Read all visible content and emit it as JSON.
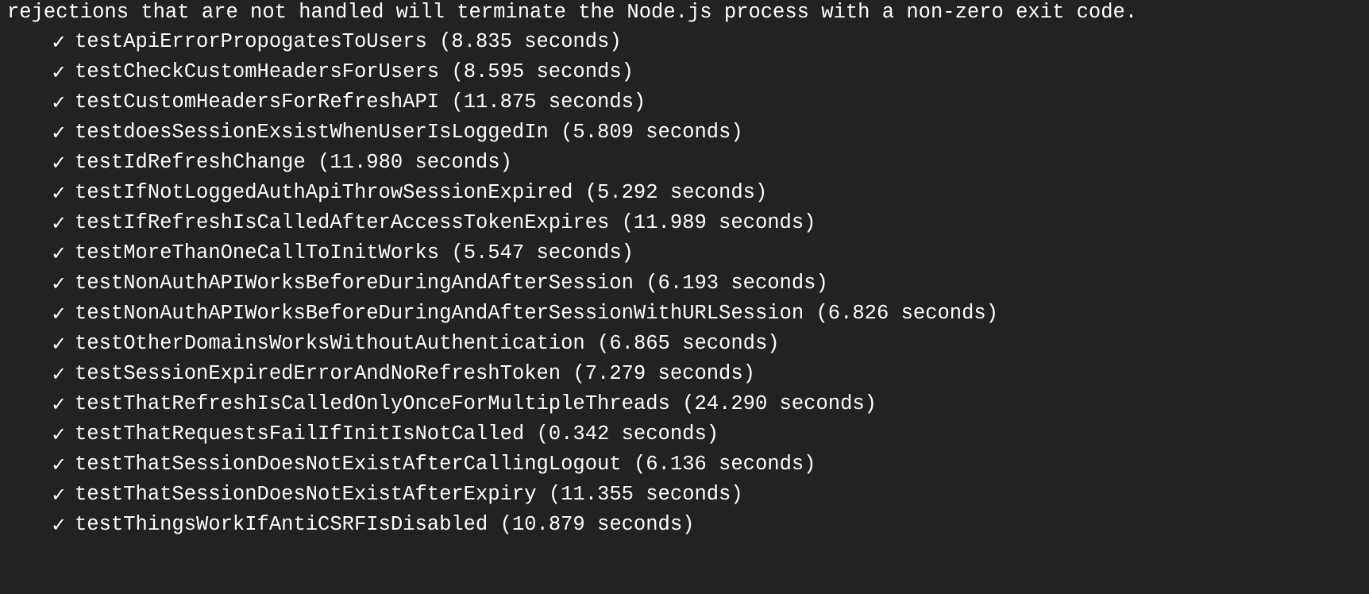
{
  "terminal": {
    "header_line": "rejections that are not handled will terminate the Node.js process with a non-zero exit code.",
    "check_glyph": "✓",
    "tests": [
      {
        "name": "testApiErrorPropogatesToUsers",
        "duration": "(8.835 seconds)"
      },
      {
        "name": "testCheckCustomHeadersForUsers",
        "duration": "(8.595 seconds)"
      },
      {
        "name": "testCustomHeadersForRefreshAPI",
        "duration": "(11.875 seconds)"
      },
      {
        "name": "testdoesSessionExsistWhenUserIsLoggedIn",
        "duration": "(5.809 seconds)"
      },
      {
        "name": "testIdRefreshChange",
        "duration": "(11.980 seconds)"
      },
      {
        "name": "testIfNotLoggedAuthApiThrowSessionExpired",
        "duration": "(5.292 seconds)"
      },
      {
        "name": "testIfRefreshIsCalledAfterAccessTokenExpires",
        "duration": "(11.989 seconds)"
      },
      {
        "name": "testMoreThanOneCallToInitWorks",
        "duration": "(5.547 seconds)"
      },
      {
        "name": "testNonAuthAPIWorksBeforeDuringAndAfterSession",
        "duration": "(6.193 seconds)"
      },
      {
        "name": "testNonAuthAPIWorksBeforeDuringAndAfterSessionWithURLSession",
        "duration": "(6.826 seconds)"
      },
      {
        "name": "testOtherDomainsWorksWithoutAuthentication",
        "duration": "(6.865 seconds)"
      },
      {
        "name": "testSessionExpiredErrorAndNoRefreshToken",
        "duration": "(7.279 seconds)"
      },
      {
        "name": "testThatRefreshIsCalledOnlyOnceForMultipleThreads",
        "duration": "(24.290 seconds)"
      },
      {
        "name": "testThatRequestsFailIfInitIsNotCalled",
        "duration": "(0.342 seconds)"
      },
      {
        "name": "testThatSessionDoesNotExistAfterCallingLogout",
        "duration": "(6.136 seconds)"
      },
      {
        "name": "testThatSessionDoesNotExistAfterExpiry",
        "duration": "(11.355 seconds)"
      },
      {
        "name": "testThingsWorkIfAntiCSRFIsDisabled",
        "duration": "(10.879 seconds)"
      }
    ]
  },
  "colors": {
    "background": "#222222",
    "text": "#ffffff"
  }
}
